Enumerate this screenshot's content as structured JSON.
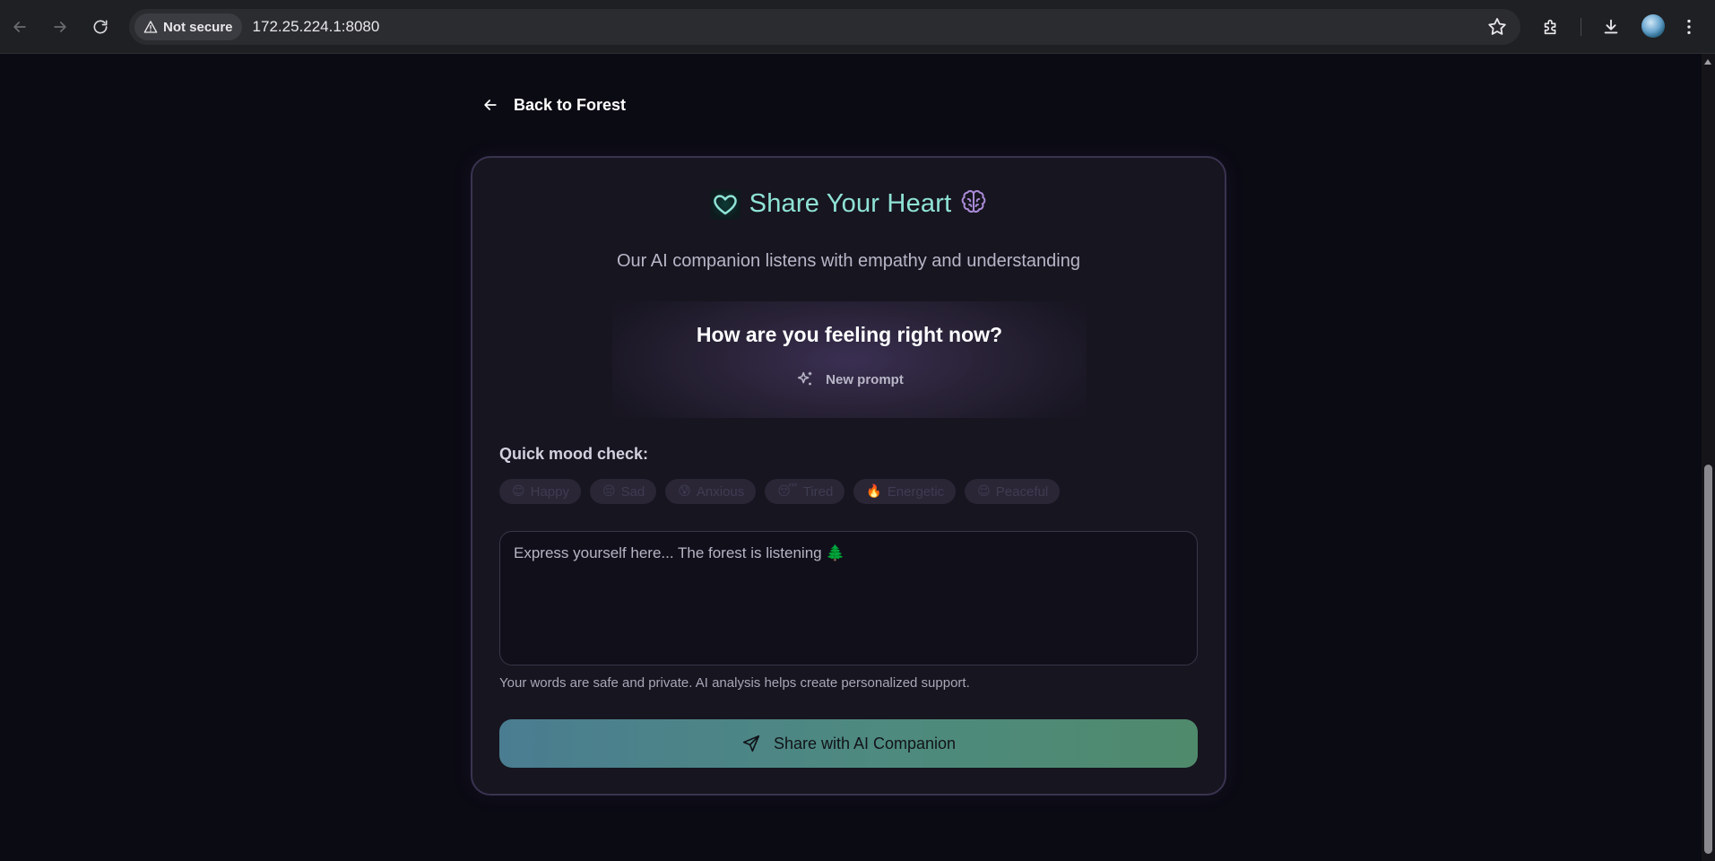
{
  "browser": {
    "security_label": "Not secure",
    "url": "172.25.224.1:8080"
  },
  "nav": {
    "back_label": "Back to Forest"
  },
  "card": {
    "title": "Share Your Heart",
    "subtitle": "Our AI companion listens with empathy and understanding",
    "prompt_question": "How are you feeling right now?",
    "new_prompt_label": "New prompt",
    "mood_label": "Quick mood check:",
    "moods": [
      {
        "emoji": "😊",
        "label": "Happy"
      },
      {
        "emoji": "😔",
        "label": "Sad"
      },
      {
        "emoji": "😰",
        "label": "Anxious"
      },
      {
        "emoji": "😴",
        "label": "Tired"
      },
      {
        "emoji": "🔥",
        "label": "Energetic"
      },
      {
        "emoji": "😌",
        "label": "Peaceful"
      }
    ],
    "textarea_placeholder": "Express yourself here... The forest is listening 🌲",
    "privacy_note": "Your words are safe and private. AI analysis helps create personalized support.",
    "share_button_label": "Share with AI Companion"
  },
  "colors": {
    "background": "#0b0b14",
    "card": "#17151f",
    "title_accent": "#8fe3d6",
    "brain_accent": "#a98ad6",
    "button_gradient_start": "#4a7d91",
    "button_gradient_end": "#4f8a6c"
  },
  "icons": {
    "nav": [
      "back-arrow-icon",
      "forward-arrow-icon",
      "reload-icon"
    ],
    "toolbar": [
      "star-icon",
      "extensions-icon",
      "download-icon",
      "menu-icon"
    ],
    "title": [
      "heart-icon",
      "brain-icon"
    ],
    "prompt": "sparkles-icon",
    "share": "send-icon"
  }
}
